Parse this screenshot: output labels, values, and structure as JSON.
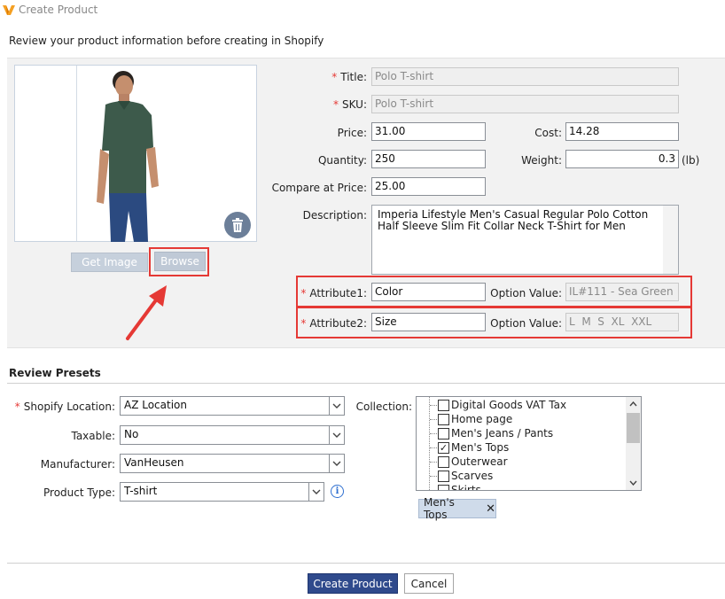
{
  "window": {
    "title": "Create Product"
  },
  "subtitle": "Review your product information before creating in Shopify",
  "image": {
    "get_image_label": "Get Image",
    "browse_label": "Browse"
  },
  "fields": {
    "title": {
      "label": "Title:",
      "value": "Polo T-shirt"
    },
    "sku": {
      "label": "SKU:",
      "value": "Polo T-shirt"
    },
    "price": {
      "label": "Price:",
      "value": "31.00"
    },
    "cost": {
      "label": "Cost:",
      "value": "14.28"
    },
    "quantity": {
      "label": "Quantity:",
      "value": "250"
    },
    "weight": {
      "label": "Weight:",
      "value": "0.3",
      "unit": "(lb)"
    },
    "compare_at_price": {
      "label": "Compare at Price:",
      "value": "25.00"
    },
    "description": {
      "label": "Description:",
      "value": "Imperia Lifestyle Men's Casual Regular Polo Cotton Half Sleeve Slim Fit Collar Neck T-Shirt for Men"
    },
    "attribute1": {
      "label": "Attribute1:",
      "value": "Color",
      "option_label": "Option Value:",
      "option_value": "IL#111 - Sea Green"
    },
    "attribute2": {
      "label": "Attribute2:",
      "value": "Size",
      "option_label": "Option Value:",
      "option_value": "L  M  S  XL  XXL"
    }
  },
  "presets": {
    "title": "Review Presets",
    "shopify_location": {
      "label": "Shopify Location:",
      "value": "AZ Location"
    },
    "taxable": {
      "label": "Taxable:",
      "value": "No"
    },
    "manufacturer": {
      "label": "Manufacturer:",
      "value": "VanHeusen"
    },
    "product_type": {
      "label": "Product Type:",
      "value": "T-shirt"
    },
    "collection": {
      "label": "Collection:",
      "items": [
        {
          "label": "Digital Goods VAT Tax",
          "checked": false
        },
        {
          "label": "Home page",
          "checked": false
        },
        {
          "label": "Men's Jeans / Pants",
          "checked": false
        },
        {
          "label": "Men's Tops",
          "checked": true
        },
        {
          "label": "Outerwear",
          "checked": false
        },
        {
          "label": "Scarves",
          "checked": false
        },
        {
          "label": "Skirts",
          "checked": false
        }
      ],
      "selected_tag": "Men's Tops"
    }
  },
  "actions": {
    "create_label": "Create Product",
    "cancel_label": "Cancel"
  },
  "colors": {
    "accent": "#2f4a8c",
    "highlight": "#e53935",
    "shirt": "#3d5a4b"
  }
}
